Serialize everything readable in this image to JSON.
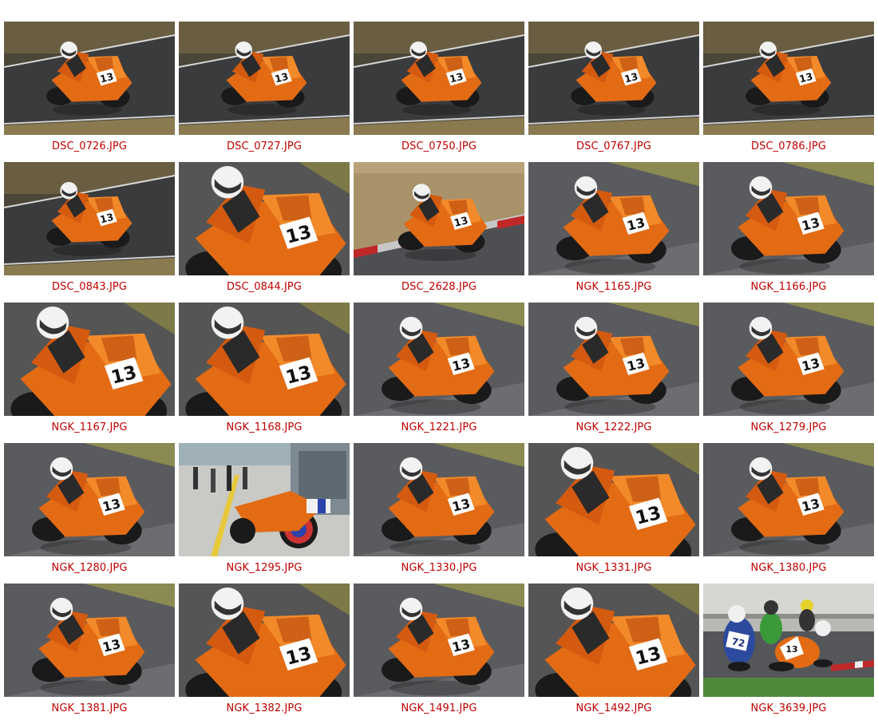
{
  "gallery": {
    "items": [
      {
        "label": "DSC_0726.JPG",
        "scene": "track"
      },
      {
        "label": "DSC_0727.JPG",
        "scene": "track"
      },
      {
        "label": "DSC_0750.JPG",
        "scene": "track"
      },
      {
        "label": "DSC_0767.JPG",
        "scene": "track"
      },
      {
        "label": "DSC_0786.JPG",
        "scene": "track"
      },
      {
        "label": "DSC_0843.JPG",
        "scene": "track"
      },
      {
        "label": "DSC_0844.JPG",
        "scene": "closeup"
      },
      {
        "label": "DSC_2628.JPG",
        "scene": "kerb"
      },
      {
        "label": "NGK_1165.JPG",
        "scene": "lean"
      },
      {
        "label": "NGK_1166.JPG",
        "scene": "lean"
      },
      {
        "label": "NGK_1167.JPG",
        "scene": "closeup"
      },
      {
        "label": "NGK_1168.JPG",
        "scene": "closeup"
      },
      {
        "label": "NGK_1221.JPG",
        "scene": "lean"
      },
      {
        "label": "NGK_1222.JPG",
        "scene": "lean"
      },
      {
        "label": "NGK_1279.JPG",
        "scene": "lean"
      },
      {
        "label": "NGK_1280.JPG",
        "scene": "lean"
      },
      {
        "label": "NGK_1295.JPG",
        "scene": "pit"
      },
      {
        "label": "NGK_1330.JPG",
        "scene": "lean"
      },
      {
        "label": "NGK_1331.JPG",
        "scene": "closeup"
      },
      {
        "label": "NGK_1380.JPG",
        "scene": "lean"
      },
      {
        "label": "NGK_1381.JPG",
        "scene": "lean"
      },
      {
        "label": "NGK_1382.JPG",
        "scene": "closeup"
      },
      {
        "label": "NGK_1491.JPG",
        "scene": "lean"
      },
      {
        "label": "NGK_1492.JPG",
        "scene": "closeup"
      },
      {
        "label": "NGK_3639.JPG",
        "scene": "race"
      }
    ],
    "caption_color": "#c00000",
    "bike_number": "13",
    "race_number": "72"
  }
}
